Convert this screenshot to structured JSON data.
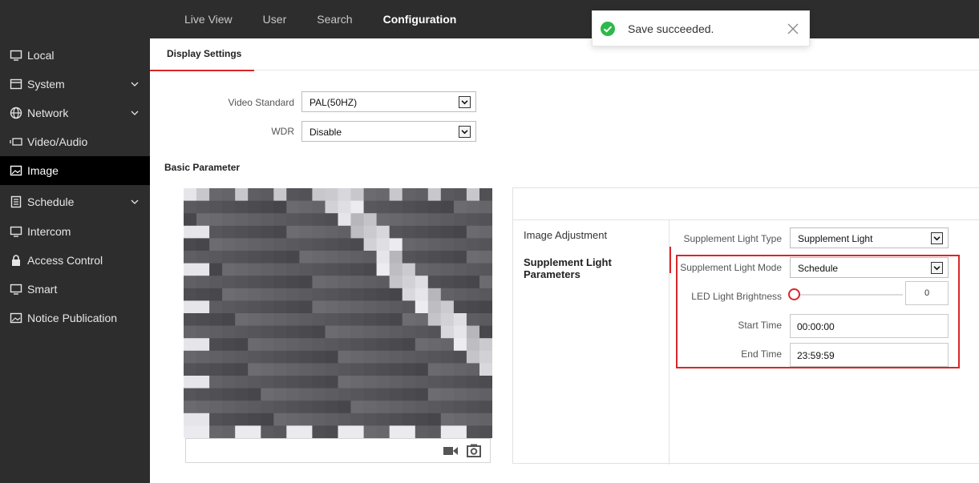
{
  "topnav": {
    "items": [
      {
        "label": "Live View",
        "active": false
      },
      {
        "label": "User",
        "active": false
      },
      {
        "label": "Search",
        "active": false
      },
      {
        "label": "Configuration",
        "active": true
      }
    ]
  },
  "toast": {
    "message": "Save succeeded.",
    "icon": "check-circle-icon",
    "color": "#2db84c"
  },
  "sidebar": {
    "items": [
      {
        "label": "Local",
        "icon": "monitor-icon"
      },
      {
        "label": "System",
        "icon": "system-icon",
        "expandable": true
      },
      {
        "label": "Network",
        "icon": "globe-icon",
        "expandable": true
      },
      {
        "label": "Video/Audio",
        "icon": "camera-icon"
      },
      {
        "label": "Image",
        "icon": "image-icon",
        "active": true
      },
      {
        "label": "Schedule",
        "icon": "schedule-icon",
        "expandable": true
      },
      {
        "label": "Intercom",
        "icon": "monitor-icon"
      },
      {
        "label": "Access Control",
        "icon": "lock-icon"
      },
      {
        "label": "Smart",
        "icon": "monitor-icon"
      },
      {
        "label": "Notice Publication",
        "icon": "image-icon"
      }
    ]
  },
  "tabs": {
    "display_settings": "Display Settings"
  },
  "form": {
    "video_standard_label": "Video Standard",
    "video_standard_value": "PAL(50HZ)",
    "wdr_label": "WDR",
    "wdr_value": "Disable"
  },
  "basic_parameter": "Basic Parameter",
  "params": {
    "menu": [
      "Image Adjustment",
      "Supplement Light Parameters"
    ],
    "supplement_light_type_label": "Supplement Light Type",
    "supplement_light_type_value": "Supplement Light",
    "supplement_light_mode_label": "Supplement Light Mode",
    "supplement_light_mode_value": "Schedule",
    "led_brightness_label": "LED Light Brightness",
    "led_brightness_value": "0",
    "start_time_label": "Start Time",
    "start_time_value": "00:00:00",
    "end_time_label": "End Time",
    "end_time_value": "23:59:59"
  },
  "colors": {
    "accent": "#d9262b",
    "nav_bg": "#2d2d2d",
    "active_bg": "#000000"
  }
}
